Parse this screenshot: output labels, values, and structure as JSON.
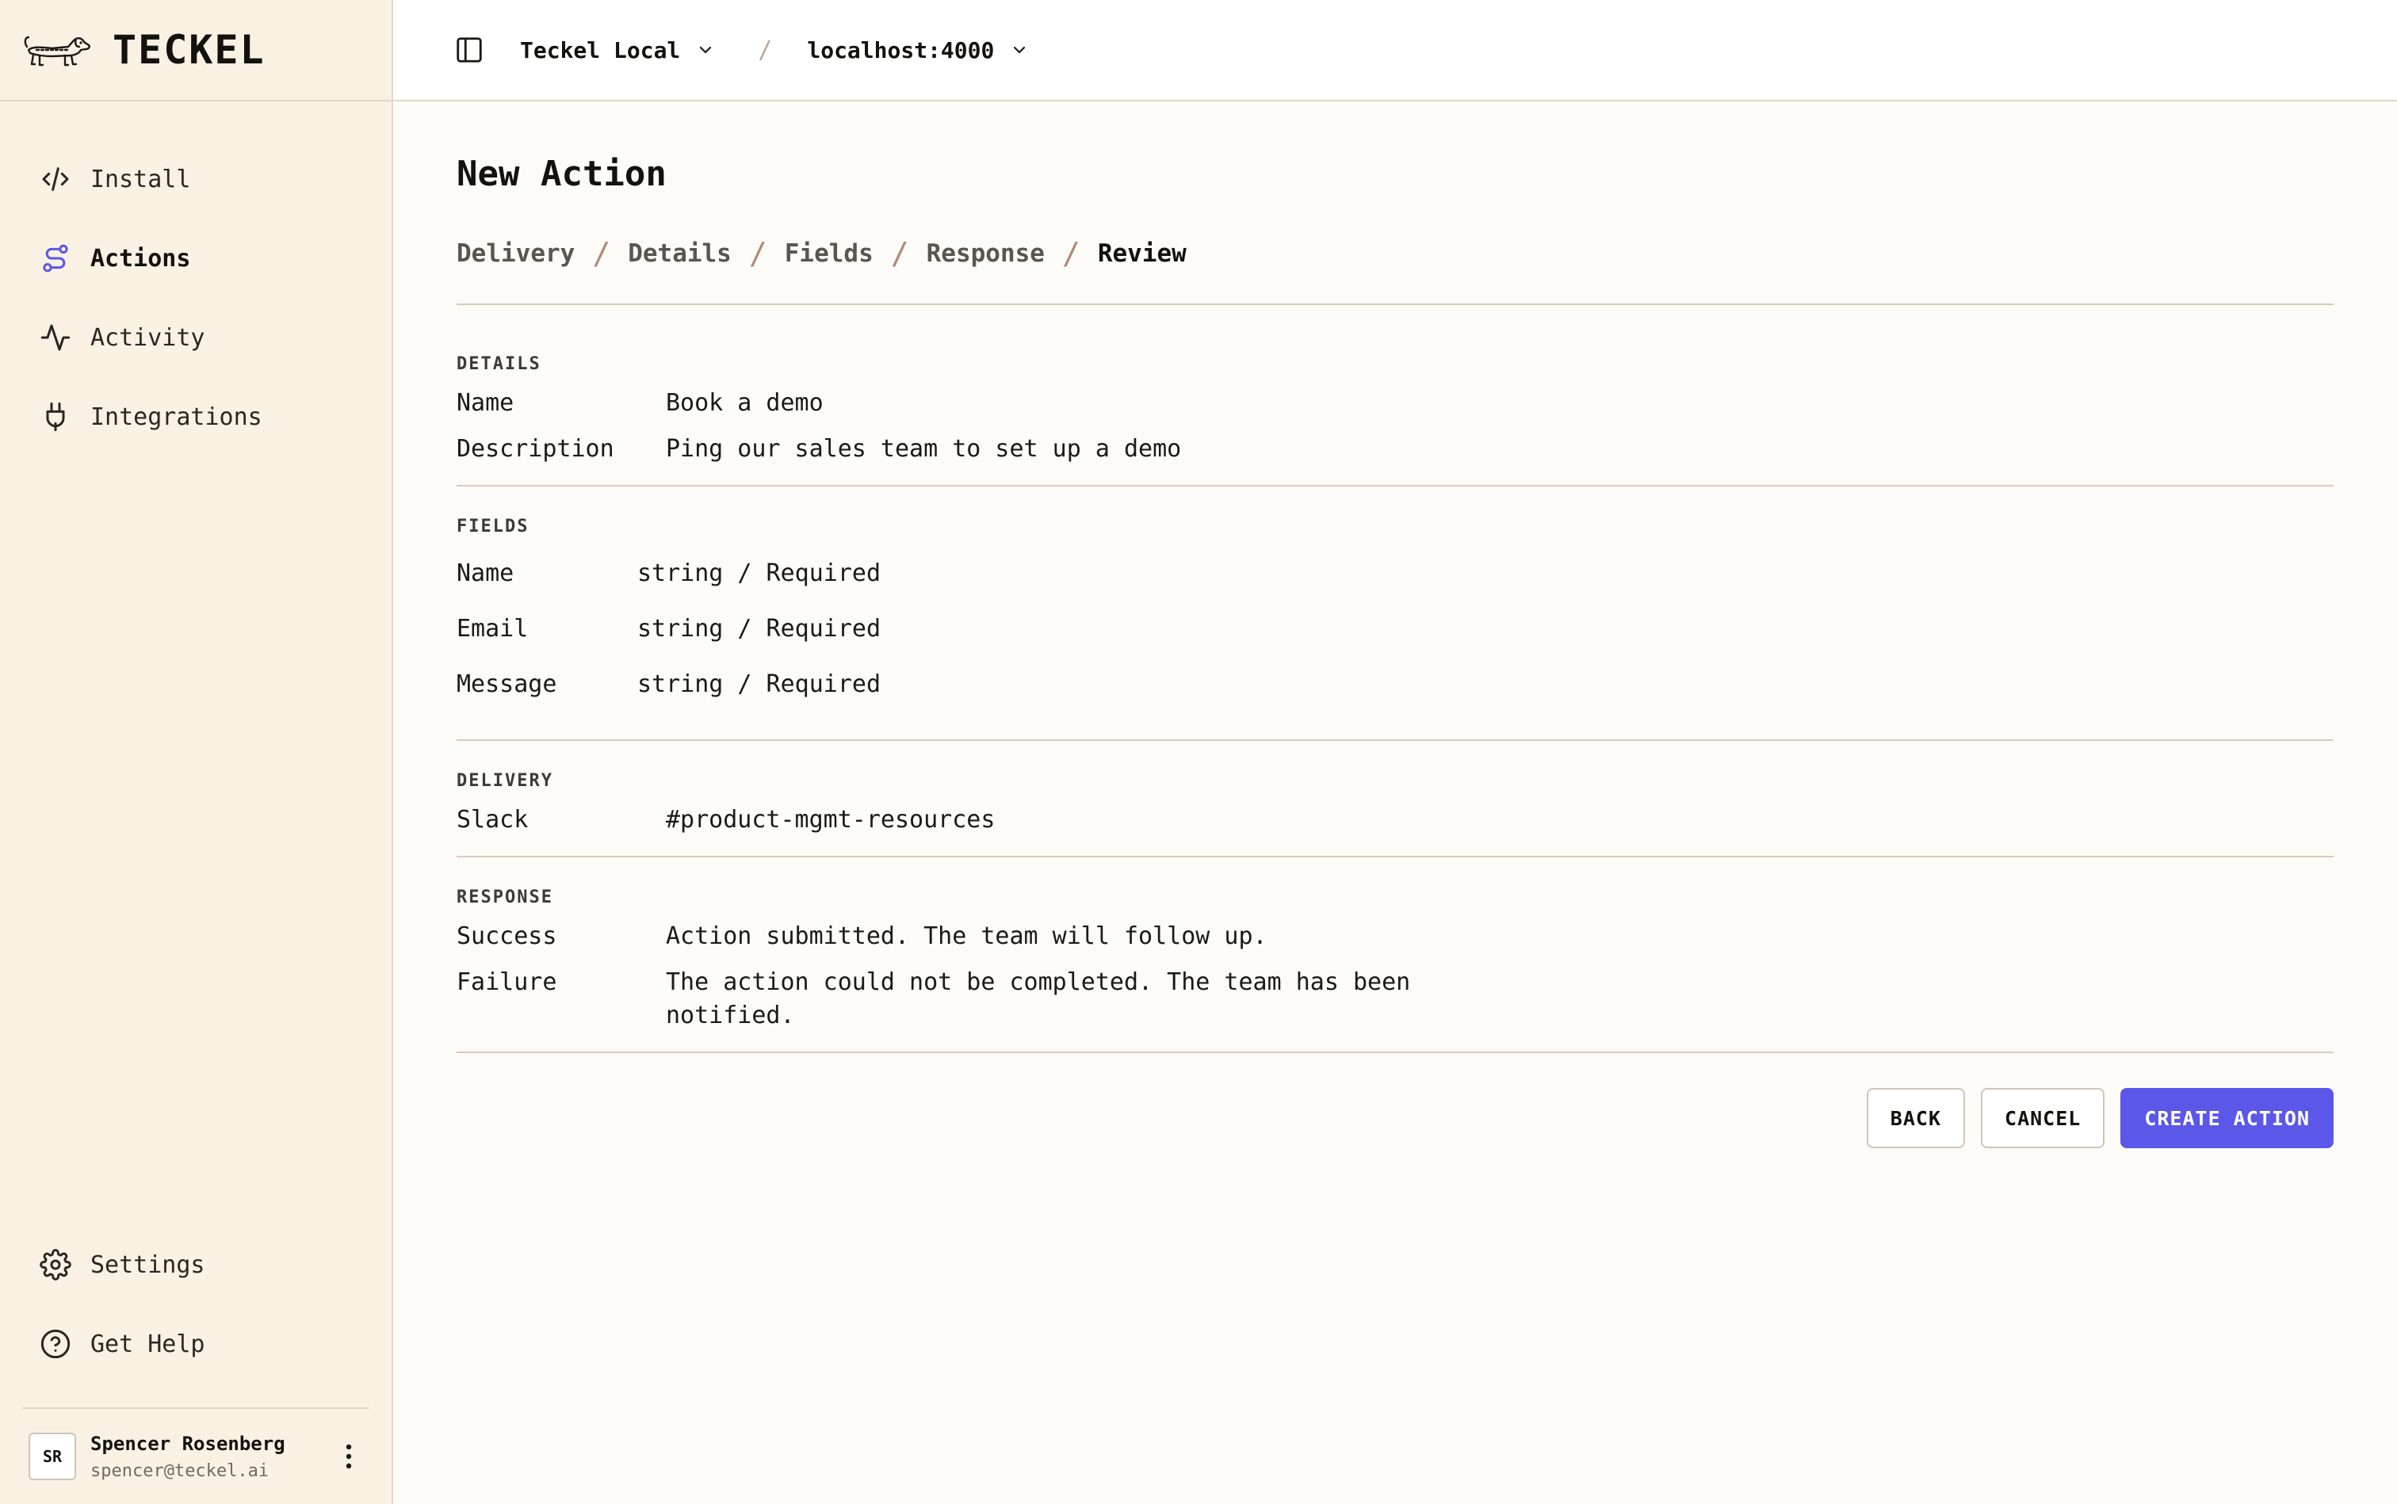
{
  "brand": {
    "name": "TECKEL"
  },
  "sidebar": {
    "items": [
      {
        "label": "Install",
        "icon": "code-icon"
      },
      {
        "label": "Actions",
        "icon": "route-icon",
        "active": true
      },
      {
        "label": "Activity",
        "icon": "activity-icon"
      },
      {
        "label": "Integrations",
        "icon": "plug-icon"
      }
    ],
    "bottom_items": [
      {
        "label": "Settings",
        "icon": "gear-icon"
      },
      {
        "label": "Get Help",
        "icon": "help-icon"
      }
    ],
    "user": {
      "initials": "SR",
      "name": "Spencer Rosenberg",
      "email": "spencer@teckel.ai"
    }
  },
  "topbar": {
    "workspace": "Teckel Local",
    "separator": "/",
    "environment": "localhost:4000"
  },
  "page": {
    "title": "New Action",
    "steps": [
      "Delivery",
      "Details",
      "Fields",
      "Response",
      "Review"
    ],
    "current_step": "Review"
  },
  "review": {
    "details": {
      "heading": "DETAILS",
      "rows": [
        {
          "key": "Name",
          "value": "Book a demo"
        },
        {
          "key": "Description",
          "value": "Ping our sales team to set up a demo"
        }
      ]
    },
    "fields": {
      "heading": "FIELDS",
      "rows": [
        {
          "key": "Name",
          "value": "string / Required"
        },
        {
          "key": "Email",
          "value": "string / Required"
        },
        {
          "key": "Message",
          "value": "string / Required"
        }
      ]
    },
    "delivery": {
      "heading": "DELIVERY",
      "rows": [
        {
          "key": "Slack",
          "value": "#product-mgmt-resources"
        }
      ]
    },
    "response": {
      "heading": "RESPONSE",
      "rows": [
        {
          "key": "Success",
          "value": "Action submitted. The team will follow up."
        },
        {
          "key": "Failure",
          "value": "The action could not be completed. The team has been notified."
        }
      ]
    }
  },
  "buttons": {
    "back": "BACK",
    "cancel": "CANCEL",
    "create": "CREATE ACTION"
  },
  "colors": {
    "accent": "#5b57e8",
    "sidebar_bg": "#f9f1e4",
    "page_bg": "#fdfbf7"
  }
}
